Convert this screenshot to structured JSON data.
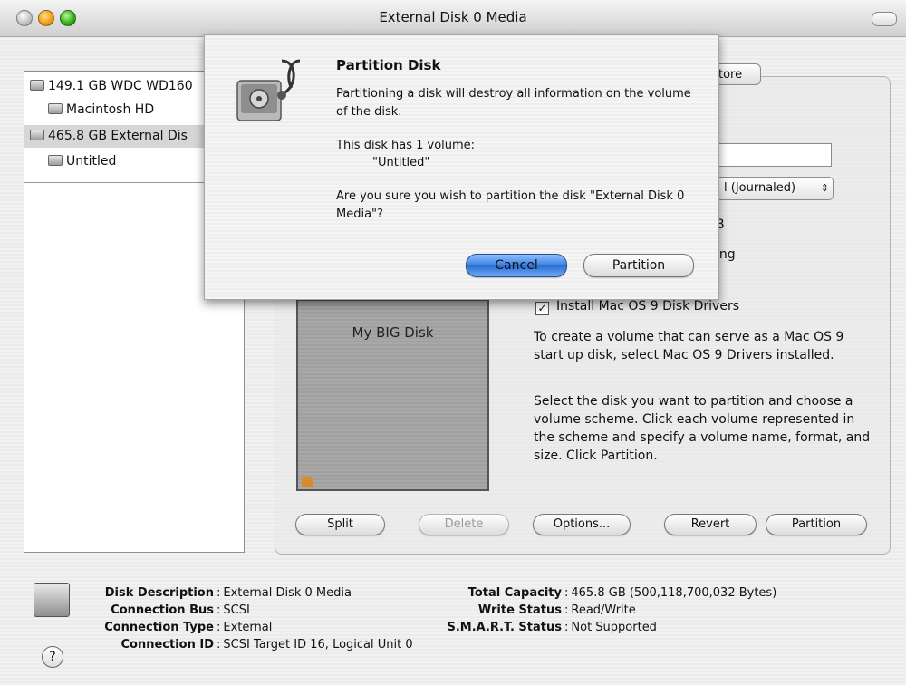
{
  "window": {
    "title": "External Disk 0 Media"
  },
  "disk_list": [
    {
      "label": "149.1 GB WDC WD160",
      "indent": false,
      "selected": false
    },
    {
      "label": "Macintosh HD",
      "indent": true,
      "selected": false
    },
    {
      "label": "465.8 GB External Dis",
      "indent": false,
      "selected": true
    },
    {
      "label": "Untitled",
      "indent": true,
      "selected": false
    }
  ],
  "tabs": {
    "restore_fragment": "tore"
  },
  "volume": {
    "format_fragment": "l (Journaled)",
    "size_fragment": "B",
    "locking_fragment": "ing"
  },
  "scheme": {
    "volume_name": "My BIG Disk"
  },
  "options": {
    "install_os9_label": "Install Mac OS 9 Disk Drivers",
    "install_os9_checked": true,
    "os9_help": "To create a volume that can serve as a Mac OS 9 start up disk, select Mac OS 9 Drivers installed.",
    "partition_help": "Select the disk you want to partition and choose a volume scheme. Click each volume represented in the scheme and specify a volume name, format, and size. Click Partition."
  },
  "buttons": {
    "split": "Split",
    "delete": "Delete",
    "options": "Options...",
    "revert": "Revert",
    "partition": "Partition"
  },
  "info": {
    "disk_description_label": "Disk Description",
    "disk_description": "External Disk 0 Media",
    "connection_bus_label": "Connection Bus",
    "connection_bus": "SCSI",
    "connection_type_label": "Connection Type",
    "connection_type": "External",
    "connection_id_label": "Connection ID",
    "connection_id": "SCSI Target ID 16, Logical Unit 0",
    "total_capacity_label": "Total Capacity",
    "total_capacity": "465.8 GB (500,118,700,032 Bytes)",
    "write_status_label": "Write Status",
    "write_status": "Read/Write",
    "smart_status_label": "S.M.A.R.T. Status",
    "smart_status": "Not Supported"
  },
  "dialog": {
    "title": "Partition Disk",
    "warning": "Partitioning a disk will destroy all information on the volume of the disk.",
    "volume_count": "This disk has 1 volume:",
    "volume_name": "\"Untitled\"",
    "question": "Are you sure you wish to partition the disk \"External Disk 0 Media\"?",
    "cancel": "Cancel",
    "partition": "Partition"
  },
  "colors": {
    "default_button": "#3b7fe0",
    "selection": "#d6d6d6"
  }
}
